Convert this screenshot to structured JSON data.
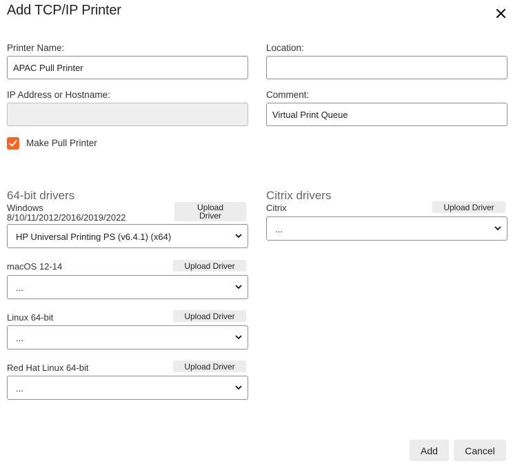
{
  "dialog": {
    "title": "Add TCP/IP Printer",
    "close_icon": "close-icon"
  },
  "form": {
    "printer_name_label": "Printer Name:",
    "printer_name_value": "APAC Pull Printer",
    "location_label": "Location:",
    "location_value": "",
    "ip_label": "IP Address or Hostname:",
    "ip_value": "",
    "comment_label": "Comment:",
    "comment_value": "Virtual Print Queue",
    "pull_printer_label": "Make Pull Printer",
    "pull_printer_checked": true
  },
  "drivers64": {
    "heading": "64-bit drivers",
    "windows": {
      "name_line1": "Windows",
      "name_line2": "8/10/11/2012/2016/2019/2022",
      "upload_line1": "Upload",
      "upload_line2": "Driver",
      "selected": "HP Universal Printing PS (v6.4.1) (x64)"
    },
    "macos": {
      "name": "macOS 12-14",
      "upload": "Upload Driver",
      "selected": "..."
    },
    "linux": {
      "name": "Linux 64-bit",
      "upload": "Upload Driver",
      "selected": "..."
    },
    "redhat": {
      "name": "Red Hat Linux 64-bit",
      "upload": "Upload Driver",
      "selected": "..."
    }
  },
  "citrix": {
    "heading": "Citrix drivers",
    "name": "Citrix",
    "upload": "Upload Driver",
    "selected": "..."
  },
  "actions": {
    "add": "Add",
    "cancel": "Cancel"
  },
  "colors": {
    "accent": "#f26522",
    "button_bg": "#ececec",
    "disabled_bg": "#efefef"
  }
}
